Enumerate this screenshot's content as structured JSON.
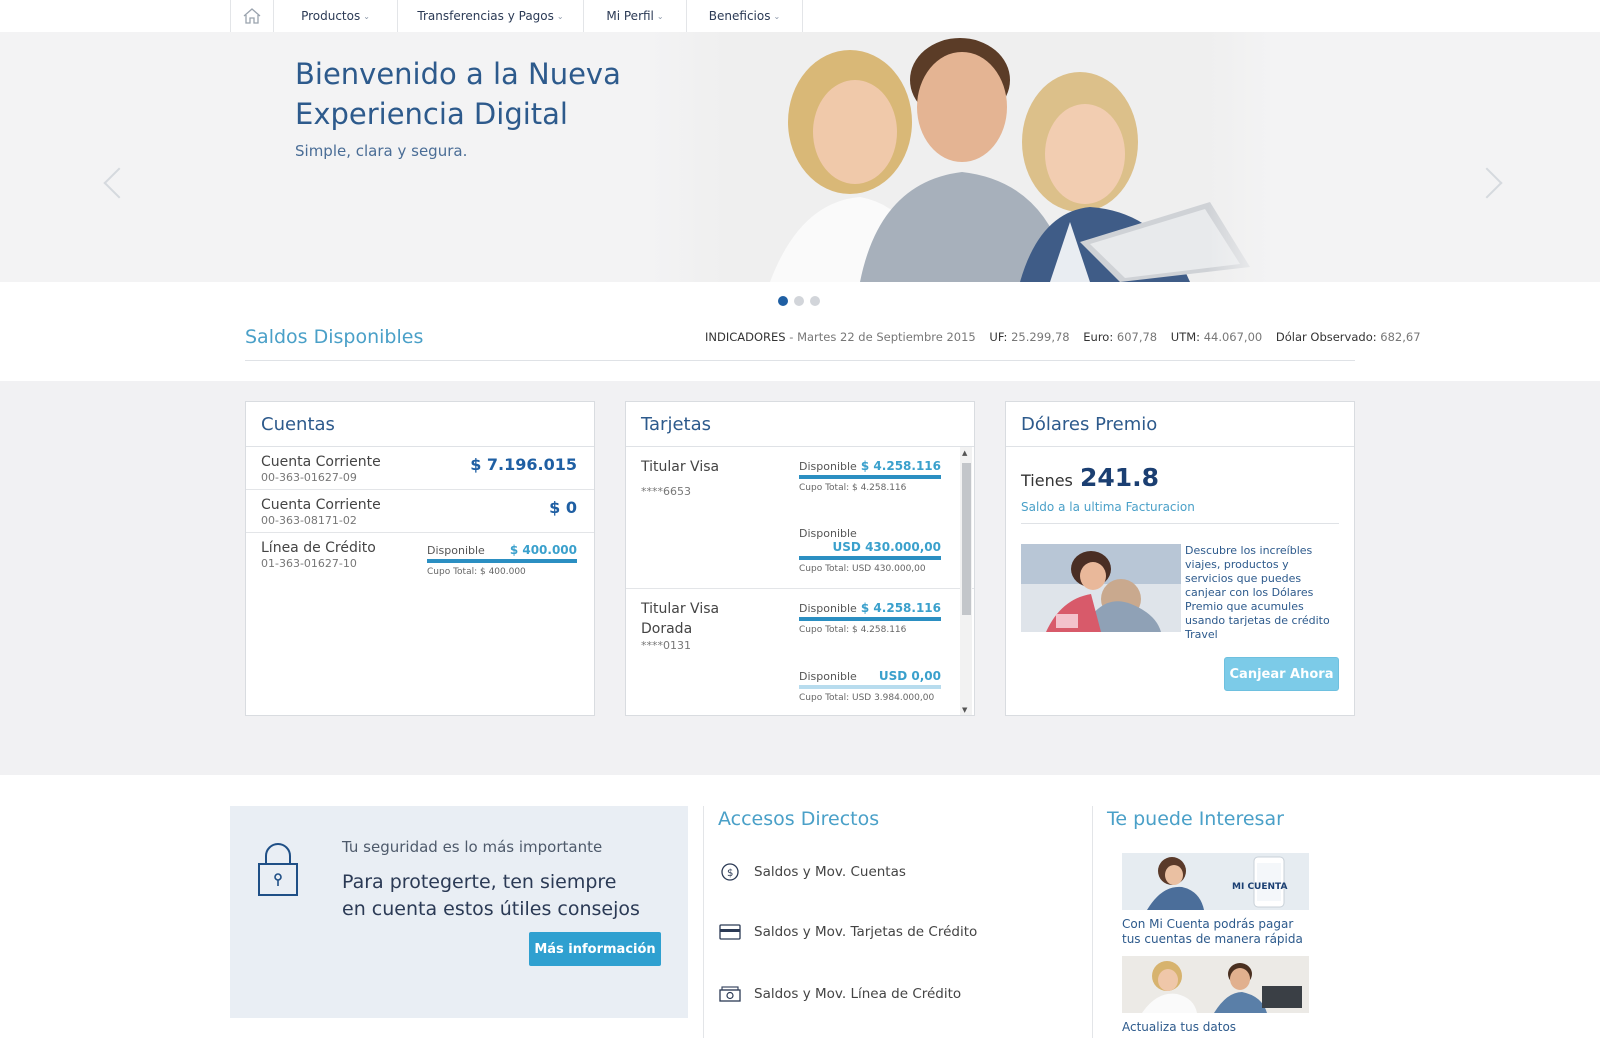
{
  "nav": {
    "items": [
      {
        "label": "Productos"
      },
      {
        "label": "Transferencias y Pagos"
      },
      {
        "label": "Mi Perfil"
      },
      {
        "label": "Beneficios"
      }
    ]
  },
  "hero": {
    "title": "Bienvenido a la Nueva Experiencia Digital",
    "subtitle": "Simple, clara y segura.",
    "slides": 3,
    "active_slide": 1
  },
  "saldos": {
    "title": "Saldos Disponibles",
    "indicadores_label": "INDICADORES",
    "fecha": " - Martes 22 de Septiembre 2015",
    "uf_label": "UF:",
    "uf_value": "25.299,78",
    "euro_label": "Euro:",
    "euro_value": "607,78",
    "utm_label": "UTM:",
    "utm_value": "44.067,00",
    "dolar_label": "Dólar Observado:",
    "dolar_value": "682,67"
  },
  "cuentas": {
    "title": "Cuentas",
    "rows": [
      {
        "name": "Cuenta Corriente",
        "number": "00-363-01627-09",
        "balance": "$ 7.196.015"
      },
      {
        "name": "Cuenta Corriente",
        "number": "00-363-08171-02",
        "balance": "$ 0"
      }
    ],
    "credit": {
      "name": "Línea de Crédito",
      "number": "01-363-01627-10",
      "disp_label": "Disponible",
      "disp_value": "$ 400.000",
      "cupo": "Cupo Total: $ 400.000",
      "fill": 1.0
    }
  },
  "tarjetas": {
    "title": "Tarjetas",
    "cards": [
      {
        "name": "Titular Visa",
        "number": "****6653",
        "nat_label": "Disponible",
        "nat_value": "$ 4.258.116",
        "nat_cupo": "Cupo Total: $ 4.258.116",
        "int_label": "Disponible",
        "int_value": "USD 430.000,00",
        "int_cupo": "Cupo Total: USD 430.000,00"
      },
      {
        "name": "Titular Visa Dorada",
        "number": "****0131",
        "nat_label": "Disponible",
        "nat_value": "$ 4.258.116",
        "nat_cupo": "Cupo Total: $ 4.258.116",
        "int_label": "Disponible",
        "int_value": "USD 0,00",
        "int_cupo": "Cupo Total: USD 3.984.000,00"
      }
    ]
  },
  "dolares": {
    "title": "Dólares Premio",
    "tienes": "Tienes",
    "points": "241.8",
    "subtitle": "Saldo a la ultima Facturacion",
    "promo": "Descubre los increíbles viajes, productos y servicios que puedes canjear con los Dólares Premio que acumules usando tarjetas de crédito Travel",
    "button": "Canjear Ahora"
  },
  "seguridad": {
    "kicker": "Tu seguridad es lo más importante",
    "main": "Para protegerte, ten siempre en cuenta estos útiles consejos",
    "button": "Más información"
  },
  "accesos": {
    "title": "Accesos Directos",
    "items": [
      {
        "label": "Saldos y Mov. Cuentas",
        "icon": "coin-icon"
      },
      {
        "label": "Saldos y Mov. Tarjetas de Crédito",
        "icon": "credit-card-icon"
      },
      {
        "label": "Saldos y Mov. Línea de Crédito",
        "icon": "banknote-icon"
      }
    ]
  },
  "interesar": {
    "title": "Te puede Interesar",
    "items": [
      {
        "text": "Con Mi Cuenta podrás pagar tus cuentas de manera rápida",
        "badge": "MI CUENTA"
      },
      {
        "text": "Actualiza tus datos"
      }
    ]
  },
  "colors": {
    "brand_blue": "#2d5a8c",
    "accent_light_blue": "#4aa0c8",
    "button_blue": "#2fa0d0",
    "canjear_button": "#7ccbe8"
  }
}
